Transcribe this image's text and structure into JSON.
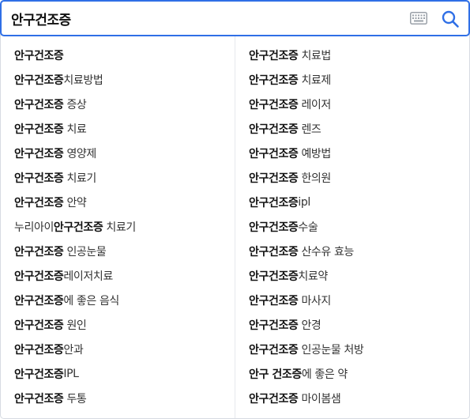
{
  "search": {
    "query": "안구건조증",
    "keyboard_icon": "keyboard-icon",
    "search_icon": "search-icon",
    "accent_color": "#2f6fe6"
  },
  "suggestions_left": [
    {
      "bold": "안구건조증",
      "rest": ""
    },
    {
      "bold": "안구건조증",
      "rest": "치료방법"
    },
    {
      "bold": "안구건조증",
      "rest": " 증상"
    },
    {
      "bold": "안구건조증",
      "rest": " 치료"
    },
    {
      "bold": "안구건조증",
      "rest": " 영양제"
    },
    {
      "bold": "안구건조증",
      "rest": " 치료기"
    },
    {
      "bold": "안구건조증",
      "rest": " 안약"
    },
    {
      "pre": "누리아이 ",
      "bold": "안구건조증",
      "rest": " 치료기"
    },
    {
      "bold": "안구건조증",
      "rest": " 인공눈물"
    },
    {
      "bold": "안구건조증",
      "rest": "레이저치료"
    },
    {
      "bold": "안구건조증",
      "rest": "에 좋은 음식"
    },
    {
      "bold": "안구건조증",
      "rest": " 원인"
    },
    {
      "bold": "안구건조증",
      "rest": "안과"
    },
    {
      "bold": "안구건조증",
      "rest": "IPL"
    },
    {
      "bold": "안구건조증",
      "rest": " 두통"
    }
  ],
  "suggestions_right": [
    {
      "bold": "안구건조증",
      "rest": " 치료법"
    },
    {
      "bold": "안구건조증",
      "rest": " 치료제"
    },
    {
      "bold": "안구건조증",
      "rest": " 레이저"
    },
    {
      "bold": "안구건조증",
      "rest": " 렌즈"
    },
    {
      "bold": "안구건조증",
      "rest": " 예방법"
    },
    {
      "bold": "안구건조증",
      "rest": " 한의원"
    },
    {
      "bold": "안구건조증",
      "rest": "ipl"
    },
    {
      "bold": "안구건조증",
      "rest": "수술"
    },
    {
      "bold": "안구건조증",
      "rest": " 산수유 효능"
    },
    {
      "bold": "안구건조증",
      "rest": "치료약"
    },
    {
      "bold": "안구건조증",
      "rest": " 마사지"
    },
    {
      "bold": "안구건조증",
      "rest": " 안경"
    },
    {
      "bold": "안구건조증",
      "rest": " 인공눈물 처방"
    },
    {
      "bold": "안구 건조증",
      "rest": "에 좋은 약"
    },
    {
      "bold": "안구건조증",
      "rest": " 마이봄샘"
    }
  ]
}
